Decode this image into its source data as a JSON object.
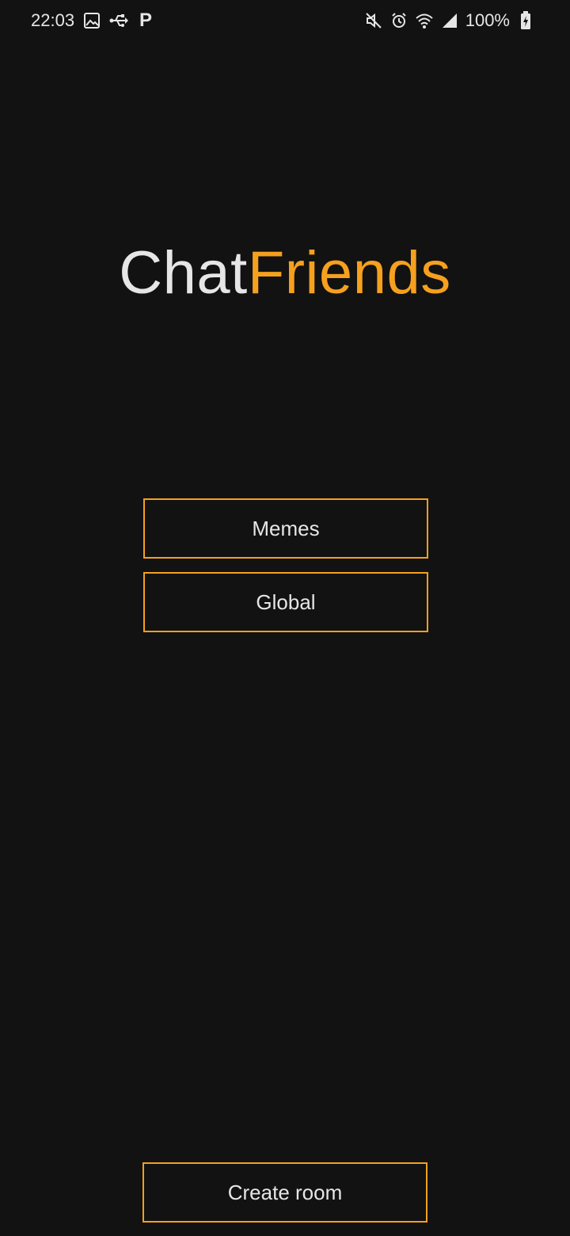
{
  "status_bar": {
    "time": "22:03",
    "battery_percent": "100%",
    "left_icons": [
      "image-icon",
      "usb-icon",
      "p-notification-icon"
    ],
    "right_icons": [
      "mute-icon",
      "alarm-icon",
      "wifi-icon",
      "signal-icon",
      "battery-charging-icon"
    ],
    "p_glyph": "P"
  },
  "app": {
    "title_part1": "Chat",
    "title_part2": "Friends"
  },
  "rooms": [
    {
      "label": "Memes"
    },
    {
      "label": "Global"
    }
  ],
  "actions": {
    "create_room_label": "Create room"
  },
  "colors": {
    "background": "#121212",
    "accent": "#f5a01e",
    "text": "#e6e6e6"
  }
}
